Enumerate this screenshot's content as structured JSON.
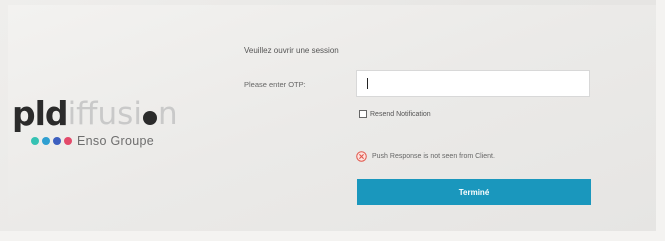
{
  "logo": {
    "wordmark_bold": "pld",
    "wordmark_light": "iffusi",
    "wordmark_end": "n",
    "tagline": "Enso Groupe",
    "dot_colors": [
      "#35c2b3",
      "#2f9fd1",
      "#3d5fbf",
      "#e34a6a"
    ]
  },
  "form": {
    "title": "Veuillez ouvrir une session",
    "otp_label": "Please enter OTP:",
    "otp_value": "",
    "resend_label": "Resend Notification",
    "resend_checked": false,
    "error_message": "Push Response is not seen from Client.",
    "error_icon": "error-x-circle-icon",
    "submit_label": "Terminé",
    "accent_color": "#1a97bd"
  }
}
